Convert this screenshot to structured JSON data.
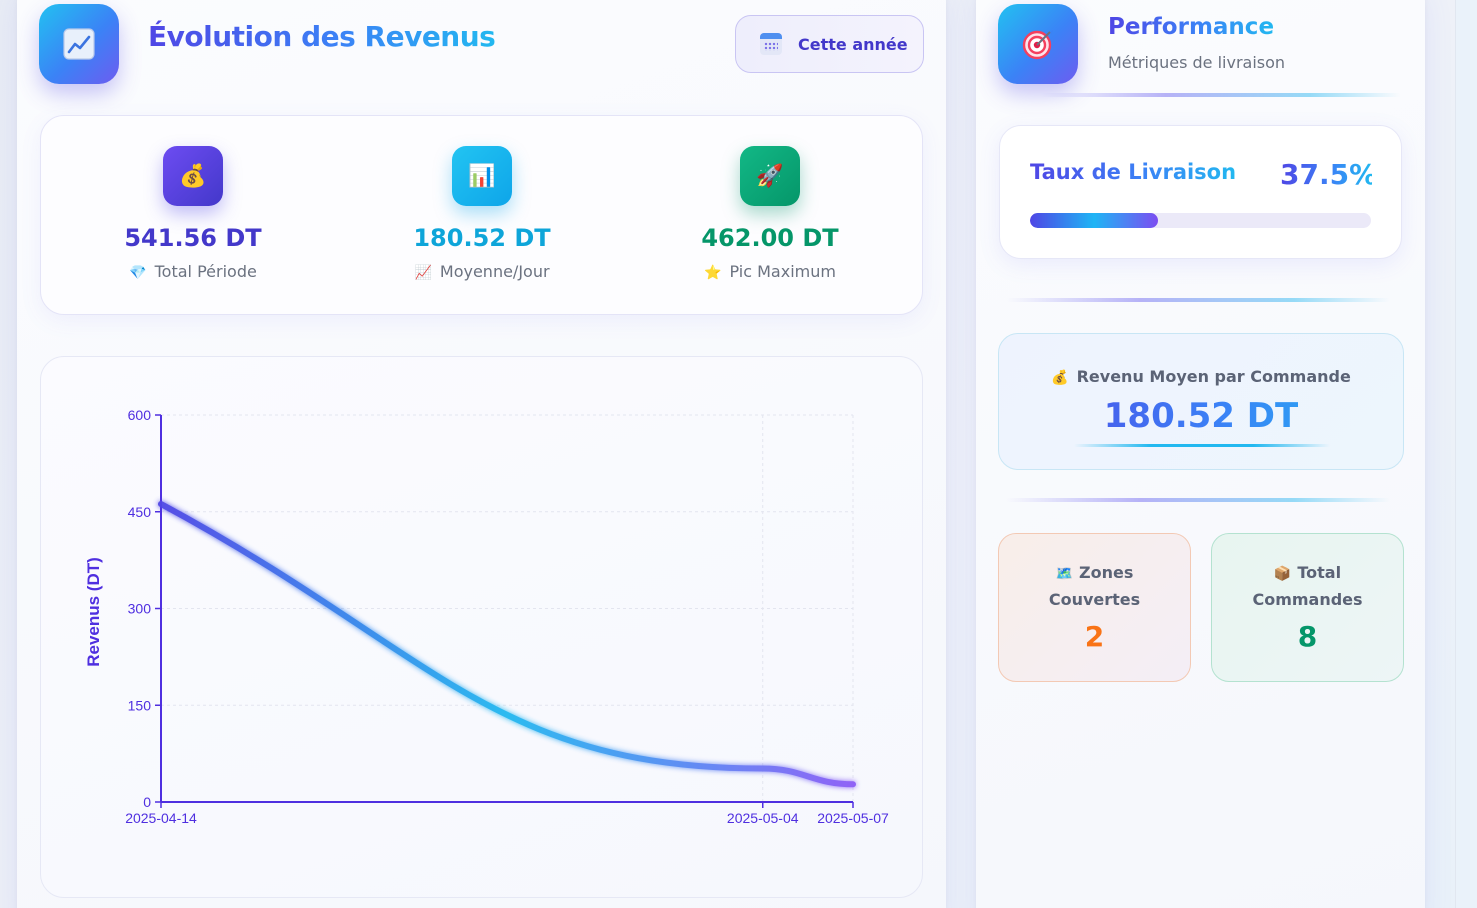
{
  "revenue_panel": {
    "title_part1": "Évolution",
    "title_part2": "des",
    "title_part3": "Revenus",
    "period_button": "Cette année",
    "stats": [
      {
        "icon": "money-bag-icon",
        "emoji": "💰",
        "value": "541.56 DT",
        "label_emoji": "💎",
        "label": "Total Période",
        "color": "#4338ca"
      },
      {
        "icon": "bar-chart-icon",
        "emoji": "📊",
        "value": "180.52 DT",
        "label_emoji": "📈",
        "label": "Moyenne/Jour",
        "color": "#0ea5d9"
      },
      {
        "icon": "rocket-icon",
        "emoji": "🚀",
        "value": "462.00 DT",
        "label_emoji": "⭐",
        "label": "Pic Maximum",
        "color": "#059669"
      }
    ]
  },
  "chart_data": {
    "type": "line",
    "ylabel": "Revenus (DT)",
    "xlabel": "",
    "x": [
      "2025-04-14",
      "2025-05-04",
      "2025-05-07"
    ],
    "yticks": [
      0,
      150,
      300,
      450,
      600
    ],
    "ylim": [
      0,
      600
    ],
    "series": [
      {
        "values": [
          462.0,
          52.0,
          27.56
        ]
      }
    ],
    "grid": true,
    "colors": {
      "axis": "#4f2fe0",
      "line_start": "#4f46e5",
      "line_mid": "#22b8f0",
      "line_end": "#8b5cf6"
    }
  },
  "performance_panel": {
    "title": "Performance",
    "subtitle": "Métriques de livraison",
    "delivery_label_part1": "Taux de",
    "delivery_label_part2": "Livraison",
    "delivery_value": "37.5%",
    "delivery_rate": 0.375,
    "avg_label_emoji": "💰",
    "avg_label": "Revenu Moyen par Commande",
    "avg_value": "180.52 DT",
    "zones_emoji": "🗺️",
    "zones_label_line1": "Zones",
    "zones_label_line2": "Couvertes",
    "zones_value": "2",
    "zones_color": "#f97316",
    "orders_emoji": "📦",
    "orders_label_line1": "Total",
    "orders_label_line2": "Commandes",
    "orders_value": "8",
    "orders_color": "#059669"
  }
}
